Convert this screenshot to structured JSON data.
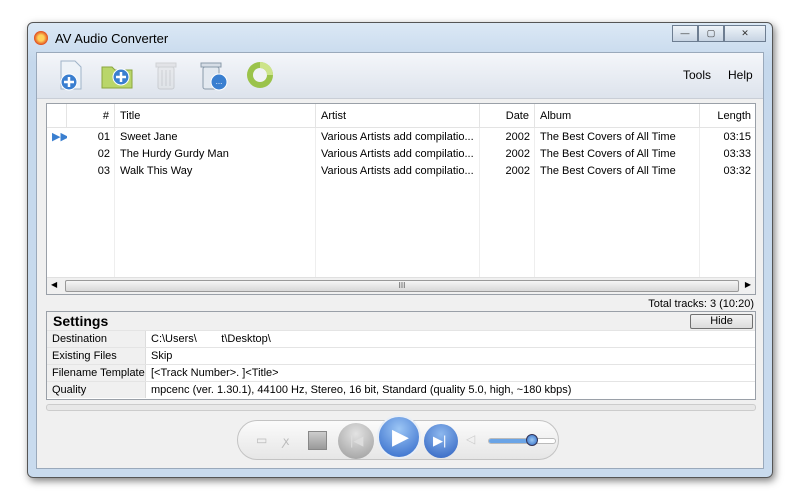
{
  "window": {
    "title": "AV Audio Converter"
  },
  "toolbar": {
    "buttons": [
      "add-files",
      "add-folder",
      "remove",
      "remove-all",
      "convert"
    ],
    "menu": [
      "Tools",
      "Help"
    ]
  },
  "list": {
    "columns": [
      "#",
      "Title",
      "Artist",
      "Date",
      "Album",
      "Length"
    ],
    "rows": [
      {
        "num": "01",
        "title": "Sweet Jane",
        "artist": "Various Artists add compilatio...",
        "date": "2002",
        "album": "The Best Covers of All Time",
        "length": "03:15",
        "playing": true
      },
      {
        "num": "02",
        "title": "The Hurdy Gurdy Man",
        "artist": "Various Artists add compilatio...",
        "date": "2002",
        "album": "The Best Covers of All Time",
        "length": "03:33"
      },
      {
        "num": "03",
        "title": "Walk This Way",
        "artist": "Various Artists add compilatio...",
        "date": "2002",
        "album": "The Best Covers of All Time",
        "length": "03:32"
      }
    ],
    "total": "Total tracks: 3 (10:20)"
  },
  "settings": {
    "title": "Settings",
    "hide_label": "Hide",
    "rows": [
      {
        "key": "Destination",
        "value": "C:\\Users\\        t\\Desktop\\"
      },
      {
        "key": "Existing Files",
        "value": "Skip"
      },
      {
        "key": "Filename Template",
        "value": "[<Track Number>. ]<Title>"
      },
      {
        "key": "Quality",
        "value": "mpcenc (ver. 1.30.1), 44100 Hz, Stereo, 16 bit, Standard (quality 5.0, high, ~180 kbps)"
      }
    ]
  },
  "player": {
    "volume": 0.65
  }
}
